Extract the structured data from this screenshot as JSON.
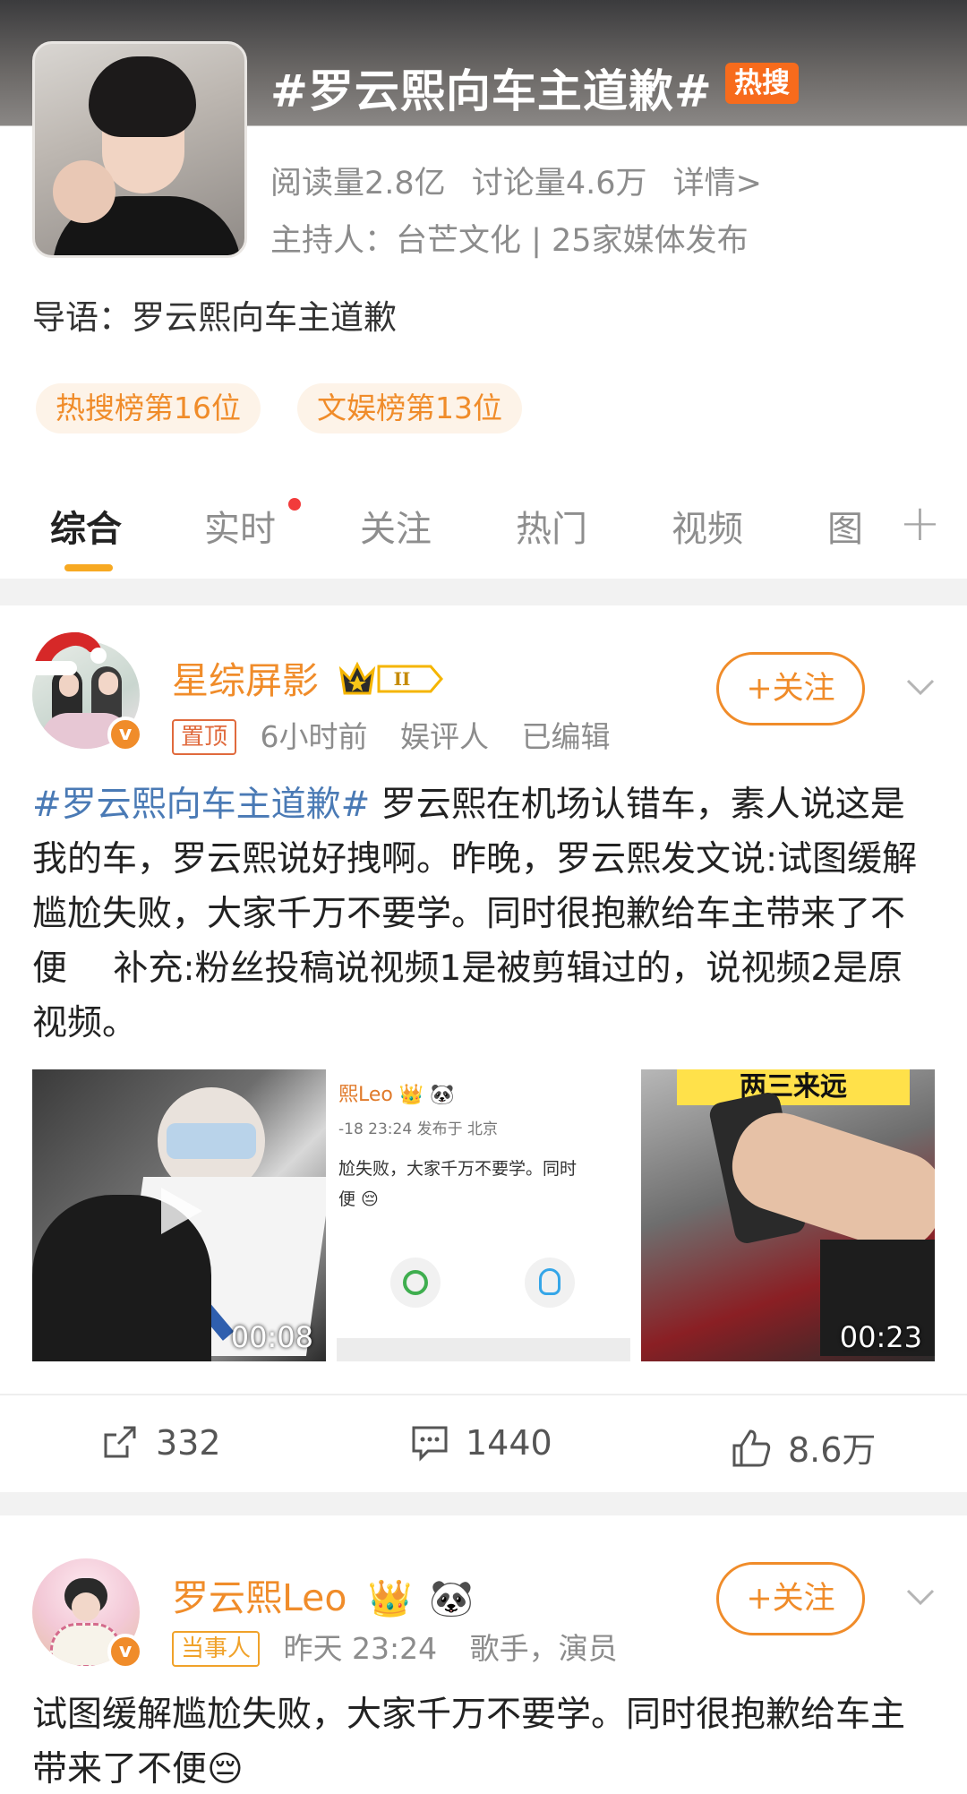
{
  "topic": {
    "title": "#罗云熙向车主道歉#",
    "hot_badge": "热搜",
    "read_count": "阅读量2.8亿",
    "discuss_count": "讨论量4.6万",
    "detail_link": "详情>",
    "host": "主持人：台芒文化 | 25家媒体发布",
    "intro": "导语：罗云熙向车主道歉",
    "ranks": [
      "热搜榜第16位",
      "文娱榜第13位"
    ]
  },
  "tabs": {
    "items": [
      "综合",
      "实时",
      "关注",
      "热门",
      "视频",
      "图"
    ],
    "active": "综合",
    "add_icon": "plus-icon"
  },
  "posts": [
    {
      "username": "星综屏影",
      "pinned_tag": "置顶",
      "time": "6小时前",
      "role": "娱评人",
      "edited": "已编辑",
      "follow_label": "+关注",
      "text_topic": "#罗云熙向车主道歉#",
      "text_body": " 罗云熙在机场认错车，素人说这是我的车，罗云熙说好拽啊。昨晚，罗云熙发文说:试图缓解尴尬失败，大家千万不要学。同时很抱歉给车主带来了不便　 补充:粉丝投稿说视频1是被剪辑过的，说视频2是原视频。",
      "media": [
        {
          "type": "video",
          "duration": "00:08"
        },
        {
          "type": "image",
          "screenshot_name": "熙Leo",
          "screenshot_meta": "-18 23:24  发布于 北京",
          "screenshot_line1": "尬失败，大家千万不要学。同时",
          "screenshot_line2": "便"
        },
        {
          "type": "video",
          "duration": "00:23",
          "caption_top": "两三来远"
        }
      ],
      "reposts": "332",
      "comments": "1440",
      "likes": "8.6万"
    },
    {
      "username": "罗云熙Leo",
      "party_tag": "当事人",
      "time": "昨天 23:24",
      "role": "歌手，演员",
      "follow_label": "+关注",
      "text_body": "试图缓解尴尬失败，大家千万不要学。同时很抱歉给车主带来了不便😔"
    }
  ],
  "colors": {
    "accent": "#f08c2a",
    "link": "#4a7ab5",
    "hot": "#f76b1c"
  }
}
